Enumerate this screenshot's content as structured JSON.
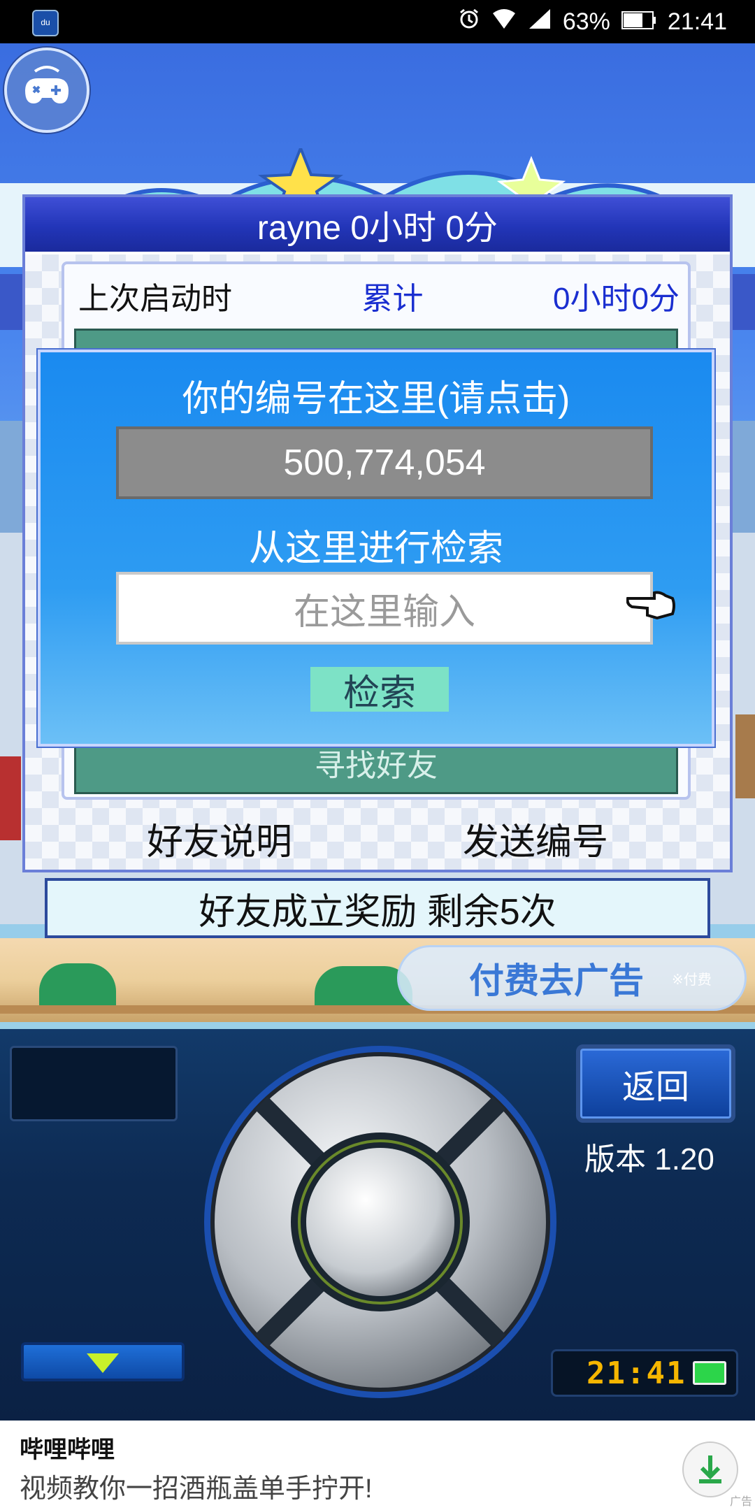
{
  "status_bar": {
    "battery": "63%",
    "time": "21:41",
    "app_icon": "du"
  },
  "panel": {
    "header": "rayne  0小时 0分",
    "last_launch_label": "上次启动时",
    "total_label": "累计",
    "total_value": "0小时0分",
    "teal_label": "寻找好友",
    "friend_help": "好友说明",
    "send_id": "发送编号"
  },
  "dialog": {
    "id_title": "你的编号在这里(请点击)",
    "id_value": "500,774,054",
    "search_title": "从这里进行检索",
    "search_placeholder": "在这里输入",
    "search_button": "检索"
  },
  "reward_text": "好友成立奖励  剩余5次",
  "ad_free": {
    "label": "付费去广告",
    "note": "※付费"
  },
  "controls": {
    "back_label": "返回",
    "version": "版本 1.20",
    "clock": "21:41"
  },
  "ad": {
    "title": "哔哩哔哩",
    "description": "视频教你一招酒瓶盖单手拧开!",
    "mark": "广告"
  },
  "colors": {
    "panel_header": "#2235b8",
    "dialog": "#1a8af0",
    "search_button": "#7de2c6",
    "id_box": "#8c8c8c",
    "teal": "#4e9a86"
  }
}
